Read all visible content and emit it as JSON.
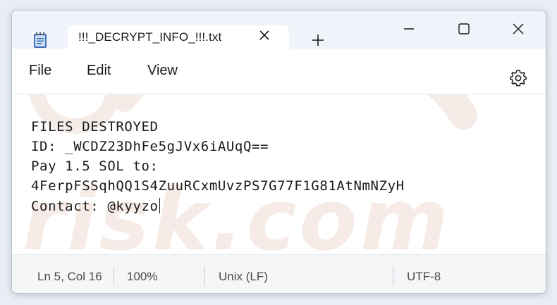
{
  "tab": {
    "title": "!!!_DECRYPT_INFO_!!!.txt",
    "close_icon": "close-icon",
    "new_tab_icon": "plus-icon"
  },
  "app_icon": "notepad-icon",
  "window_controls": {
    "minimize_icon": "minimize-icon",
    "maximize_icon": "maximize-icon",
    "close_icon": "close-icon"
  },
  "menu": {
    "file": "File",
    "edit": "Edit",
    "view": "View",
    "settings_icon": "gear-icon"
  },
  "editor": {
    "lines": [
      "FILES DESTROYED",
      "ID: _WCDZ23DhFe5gJVx6iAUqQ==",
      "Pay 1.5 SOL to:",
      "4FerpFSSqhQQ1S4ZuuRCxmUvzPS7G77F1G81AtNmNZyH",
      "Contact: @kyyzo"
    ]
  },
  "status": {
    "position": "Ln 5, Col 16",
    "zoom": "100%",
    "line_ending": "Unix (LF)",
    "encoding": "UTF-8"
  },
  "colors": {
    "titlebar_bg": "#f0f3f9",
    "editor_bg": "#ffffff",
    "text": "#1a1a1a",
    "statusbar_bg": "#f5f6f8",
    "watermark": "#f3e6e0"
  }
}
